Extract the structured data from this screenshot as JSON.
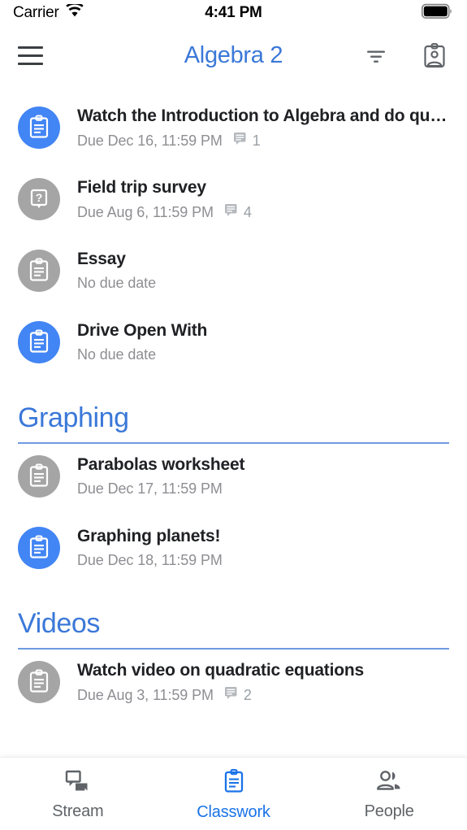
{
  "status_bar": {
    "carrier": "Carrier",
    "wifi_icon": "wifi-icon",
    "time": "4:41 PM",
    "battery_icon": "battery-full-icon"
  },
  "app_bar": {
    "menu_icon": "hamburger-menu-icon",
    "title": "Algebra 2",
    "title_color": "#3b78d8",
    "filter_icon": "filter-sort-icon",
    "profile_icon": "id-badge-icon"
  },
  "colors": {
    "accent_blue": "#4285f4",
    "link_blue": "#1a73e8",
    "avatar_gray": "#a5a5a5",
    "title_text": "#202124",
    "subtitle_text": "#8e8e93",
    "rule_blue": "#6f9be0"
  },
  "classwork": {
    "ungrouped_items": [
      {
        "title": "Watch the Introduction to Algebra and do question…",
        "due": "Due Dec 16, 11:59 PM",
        "comment_icon": "comment-icon",
        "comments": "1",
        "avatar": "assignment-icon",
        "avatar_color": "blue"
      },
      {
        "title": "Field trip survey",
        "due": "Due Aug 6, 11:59 PM",
        "comment_icon": "comment-icon",
        "comments": "4",
        "avatar": "question-icon",
        "avatar_color": "gray"
      },
      {
        "title": "Essay",
        "due": "No due date",
        "comment_icon": "",
        "comments": "",
        "avatar": "assignment-icon",
        "avatar_color": "gray"
      },
      {
        "title": "Drive Open With",
        "due": "No due date",
        "comment_icon": "",
        "comments": "",
        "avatar": "assignment-icon",
        "avatar_color": "blue"
      }
    ],
    "sections": [
      {
        "name": "Graphing",
        "items": [
          {
            "title": "Parabolas worksheet",
            "due": "Due Dec 17, 11:59 PM",
            "comment_icon": "",
            "comments": "",
            "avatar": "assignment-icon",
            "avatar_color": "gray"
          },
          {
            "title": "Graphing planets!",
            "due": "Due Dec 18, 11:59 PM",
            "comment_icon": "",
            "comments": "",
            "avatar": "assignment-icon",
            "avatar_color": "blue"
          }
        ]
      },
      {
        "name": "Videos",
        "items": [
          {
            "title": "Watch video on quadratic equations",
            "due": "Due Aug 3, 11:59 PM",
            "comment_icon": "comment-icon",
            "comments": "2",
            "avatar": "assignment-icon",
            "avatar_color": "gray"
          }
        ]
      }
    ]
  },
  "bottom_nav": {
    "items": [
      {
        "label": "Stream",
        "icon": "chat-bubbles-icon",
        "active": false
      },
      {
        "label": "Classwork",
        "icon": "clipboard-icon",
        "active": true
      },
      {
        "label": "People",
        "icon": "people-icon",
        "active": false
      }
    ]
  }
}
